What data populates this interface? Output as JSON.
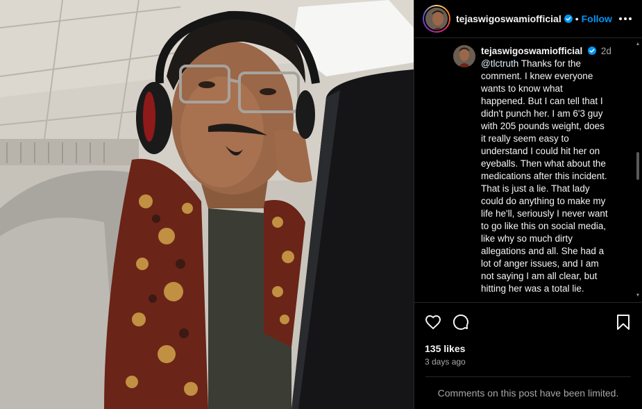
{
  "post": {
    "photo_alt_icon": "selfie-photo",
    "header": {
      "username": "tejaswigoswamiofficial",
      "verified_icon": "verified-badge-icon",
      "separator": "•",
      "follow_label": "Follow",
      "more_icon": "more-options-icon"
    },
    "comment": {
      "username": "tejaswigoswamiofficial",
      "time": "2d",
      "mention": "@tlctruth",
      "text": " Thanks for the comment. I knew everyone wants to know what happened. But I can tell that I didn't punch her. I am 6'3 guy with 205 pounds weight, does it really seem easy to understand I could hit her on eyeballs. Then what about the medications after this incident. That is just a lie. That lady could do anything to make my life he'll, seriously I never want to go like this on social media, like why so much dirty allegations and all. She had a lot of anger issues, and I am not saying I am all clear, but hitting her was a total lie."
    },
    "actions": {
      "like_icon": "heart-icon",
      "comment_icon": "comment-bubble-icon",
      "save_icon": "bookmark-icon"
    },
    "likes": "135 likes",
    "date": "3 days ago",
    "comments_limited": "Comments on this post have been limited."
  },
  "colors": {
    "accent": "#0095f6",
    "background": "#000000",
    "muted_text": "#a8a8a8",
    "divider": "#262626"
  }
}
